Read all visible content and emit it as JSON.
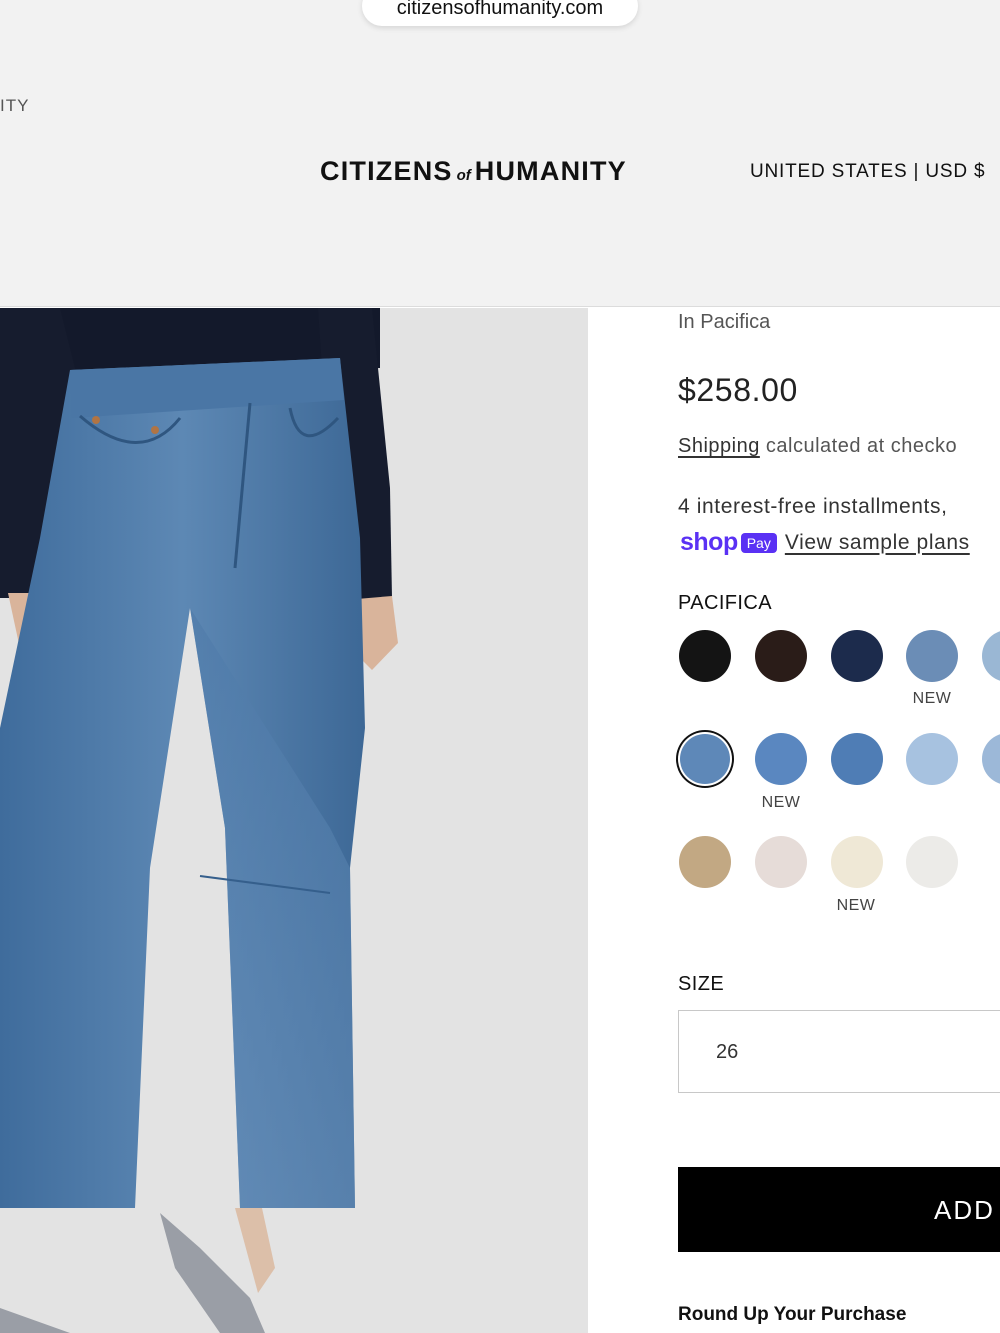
{
  "browser": {
    "url": "citizensofhumanity.com"
  },
  "header": {
    "tagline_fragment": "ITY",
    "brand_left": "CITIZENS",
    "brand_of": "of",
    "brand_right": "HUMANITY",
    "locale": "UNITED STATES | USD $"
  },
  "product": {
    "color_subtitle": "In Pacifica",
    "price": "$258.00",
    "shipping_link": "Shipping",
    "shipping_rest": " calculated at checko",
    "installments": "4 interest-free installments,",
    "shoppay_shop": "shop",
    "shoppay_pay": "Pay",
    "shoppay_link": "View sample plans"
  },
  "color": {
    "label": "PACIFICA",
    "swatches": [
      {
        "color": "#141414",
        "badge": ""
      },
      {
        "color": "#2a1c18",
        "badge": ""
      },
      {
        "color": "#1c2b4c",
        "badge": ""
      },
      {
        "color": "#6b8db6",
        "badge": "NEW"
      },
      {
        "color": "#9ab7d4",
        "badge": "N"
      },
      {
        "color": "#5e88b8",
        "badge": "",
        "selected": true
      },
      {
        "color": "#5a87c0",
        "badge": "NEW"
      },
      {
        "color": "#4f7db5",
        "badge": ""
      },
      {
        "color": "#a7c2e0",
        "badge": ""
      },
      {
        "color": "#9cb8d8",
        "badge": ""
      },
      {
        "color": "#c2a883",
        "badge": ""
      },
      {
        "color": "#e6dcd8",
        "badge": ""
      },
      {
        "color": "#efe8d6",
        "badge": "NEW"
      },
      {
        "color": "#ecebe8",
        "badge": ""
      }
    ]
  },
  "size": {
    "label": "SIZE",
    "selected": "26"
  },
  "cart": {
    "add_label": "ADD"
  },
  "roundup": {
    "label": "Round Up Your Purchase"
  }
}
